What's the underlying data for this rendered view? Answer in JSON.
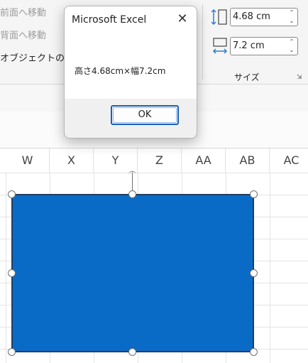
{
  "ribbon": {
    "bring_forward": "前面へ移動",
    "send_backward": "背面へ移動",
    "selection_pane": "オブジェクトの選",
    "size_group_label": "サイズ",
    "height": {
      "value": "4.68 cm"
    },
    "width": {
      "value": "7.2 cm"
    }
  },
  "columns": [
    "W",
    "X",
    "Y",
    "Z",
    "AA",
    "AB",
    "AC"
  ],
  "shape": {
    "fill": "#0a6bc6"
  },
  "dialog": {
    "title": "Microsoft Excel",
    "close_glyph": "✕",
    "message": "高さ4.68cm×幅7.2cm",
    "ok_label": "OK"
  }
}
